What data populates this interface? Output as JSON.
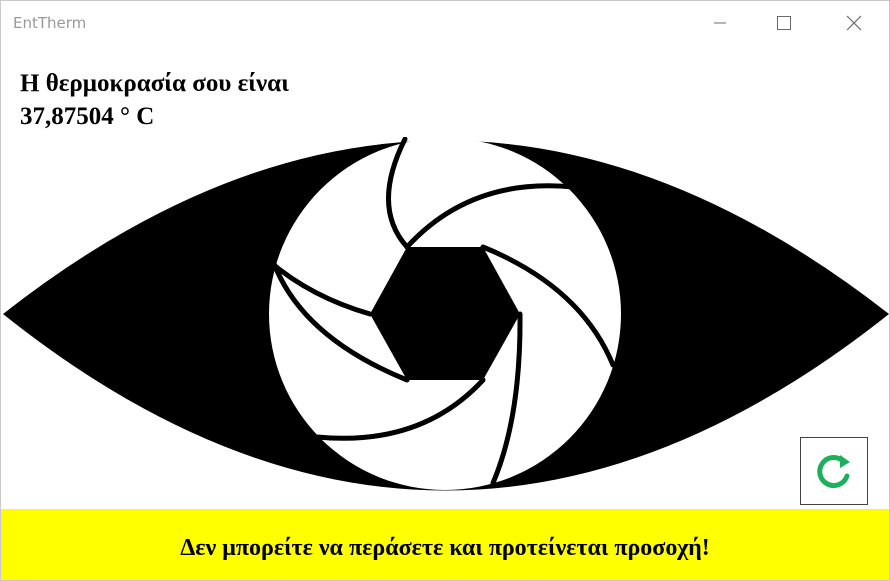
{
  "window": {
    "title": "EntTherm",
    "controls": [
      "minimize-icon",
      "maximize-icon",
      "close-icon"
    ]
  },
  "temperature": {
    "label": "Η θερμοκρασία σου είναι",
    "value": "37,87504 ° C"
  },
  "graphic": {
    "icon": "eye-aperture-icon",
    "fill_color": "#000000",
    "iris_color": "#ffffff"
  },
  "refresh_button": {
    "icon": "refresh-icon",
    "icon_color": "#1fae5b"
  },
  "warning": {
    "text": "Δεν μπορείτε να περάσετε και προτείνεται προσοχή!",
    "background": "#ffff00"
  }
}
